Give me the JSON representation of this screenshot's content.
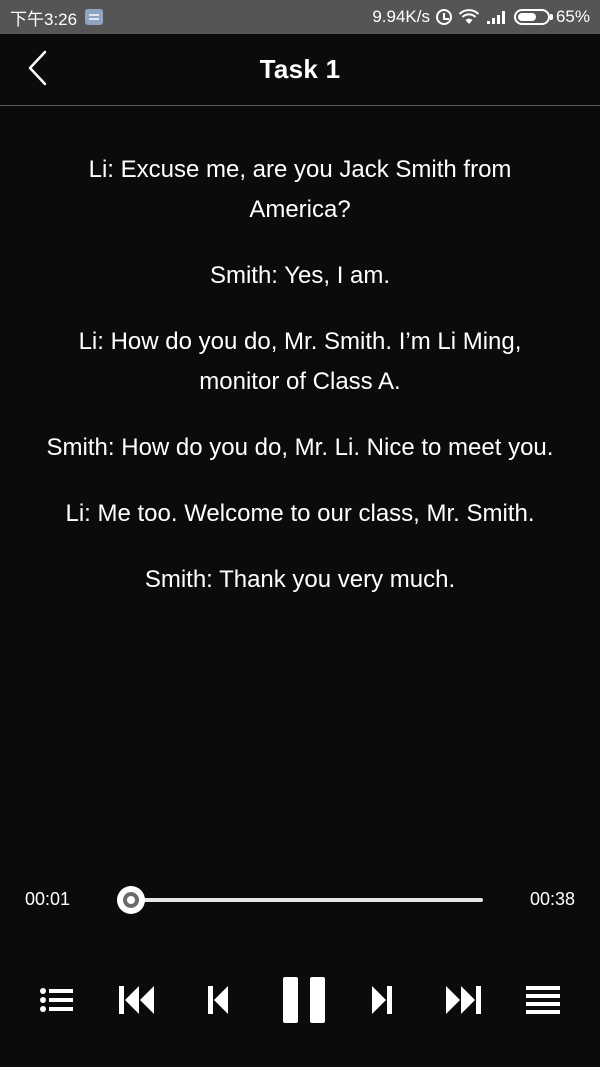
{
  "status_bar": {
    "time": "下午3:26",
    "network_speed": "9.94K/s",
    "battery": "65%",
    "battery_level": 0.65,
    "icons": [
      "notification-icon",
      "alarm-icon",
      "wifi-icon",
      "signal-icon",
      "battery-icon"
    ]
  },
  "header": {
    "title": "Task 1",
    "back_icon": "chevron-left-icon"
  },
  "transcript": {
    "lines": [
      "Li: Excuse me, are you Jack Smith from America?",
      "Smith: Yes, I am.",
      "Li: How do you do, Mr. Smith. I’m Li Ming, monitor of Class A.",
      "Smith: How do you do, Mr. Li. Nice to meet you.",
      "Li: Me too. Welcome to our class, Mr. Smith.",
      "Smith: Thank you very much."
    ]
  },
  "player": {
    "current_time": "00:01",
    "total_time": "00:38",
    "progress": 0.0,
    "controls": [
      "playlist-icon",
      "rewind-icon",
      "previous-icon",
      "pause-icon",
      "next-icon",
      "fast-forward-icon",
      "list-icon"
    ]
  },
  "colors": {
    "background": "#0b0b0b",
    "status_bar": "#555555",
    "text": "#ffffff",
    "divider": "#5a5a5a"
  }
}
